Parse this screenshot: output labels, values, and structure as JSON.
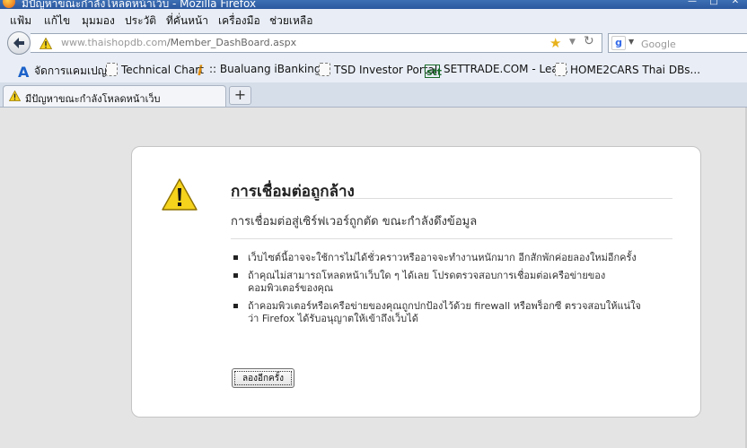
{
  "window": {
    "title": "มีปัญหาขณะกำลังโหลดหน้าเว็บ - Mozilla Firefox",
    "controls": [
      "—",
      "□",
      "✕"
    ]
  },
  "menu": [
    "แฟ้ม",
    "แก้ไข",
    "มุมมอง",
    "ประวัติ",
    "ที่คั่นหน้า",
    "เครื่องมือ",
    "ช่วยเหลือ"
  ],
  "nav": {
    "url_host": "www.thaishopdb.com",
    "url_path": "/Member_DashBoard.aspx",
    "search_placeholder": "Google",
    "search_engine_icon": "google-icon"
  },
  "bookmarks": [
    {
      "label": "จัดการแคมเปญ",
      "icon": "adwords-icon"
    },
    {
      "label": "Technical Chart",
      "icon": "page-icon"
    },
    {
      "label": ":: Bualuang iBanking ::",
      "icon": "info-i-icon"
    },
    {
      "label": "TSD Investor Portal",
      "icon": "page-icon"
    },
    {
      "label": "SETTRADE.COM - Lea...",
      "icon": "stt-icon"
    },
    {
      "label": "HOME2CARS Thai DBs...",
      "icon": "page-icon"
    }
  ],
  "tab": {
    "label": "มีปัญหาขณะกำลังโหลดหน้าเว็บ",
    "new_tab": "+"
  },
  "error": {
    "title": "การเชื่อมต่อถูกล้าง",
    "subtitle": "การเชื่อมต่อสู่เซิร์ฟเวอร์ถูกตัด ขณะกำลังดึงข้อมูล",
    "items": [
      "เว็บไซต์นี้อาจจะใช้การไม่ได้ชั่วคราวหรืออาจจะทำงานหนักมาก อีกสักพักค่อยลองใหม่อีกครั้ง",
      "ถ้าคุณไม่สามารถโหลดหน้าเว็บใด ๆ ได้เลย โปรดตรวจสอบการเชื่อมต่อเครือข่ายของคอมพิวเตอร์ของคุณ",
      "ถ้าคอมพิวเตอร์หรือเครือข่ายของคุณถูกปกป้องไว้ด้วย firewall หรือพร็อกซี ตรวจสอบให้แน่ใจว่า Firefox ได้รับอนุญาตให้เข้าถึงเว็บได้"
    ],
    "retry_label": "ลองอีกครั้ง"
  },
  "colors": {
    "warning_yellow": "#f5d21c",
    "chrome_bg": "#e9eef6",
    "title_blue": "#2b58a0"
  }
}
